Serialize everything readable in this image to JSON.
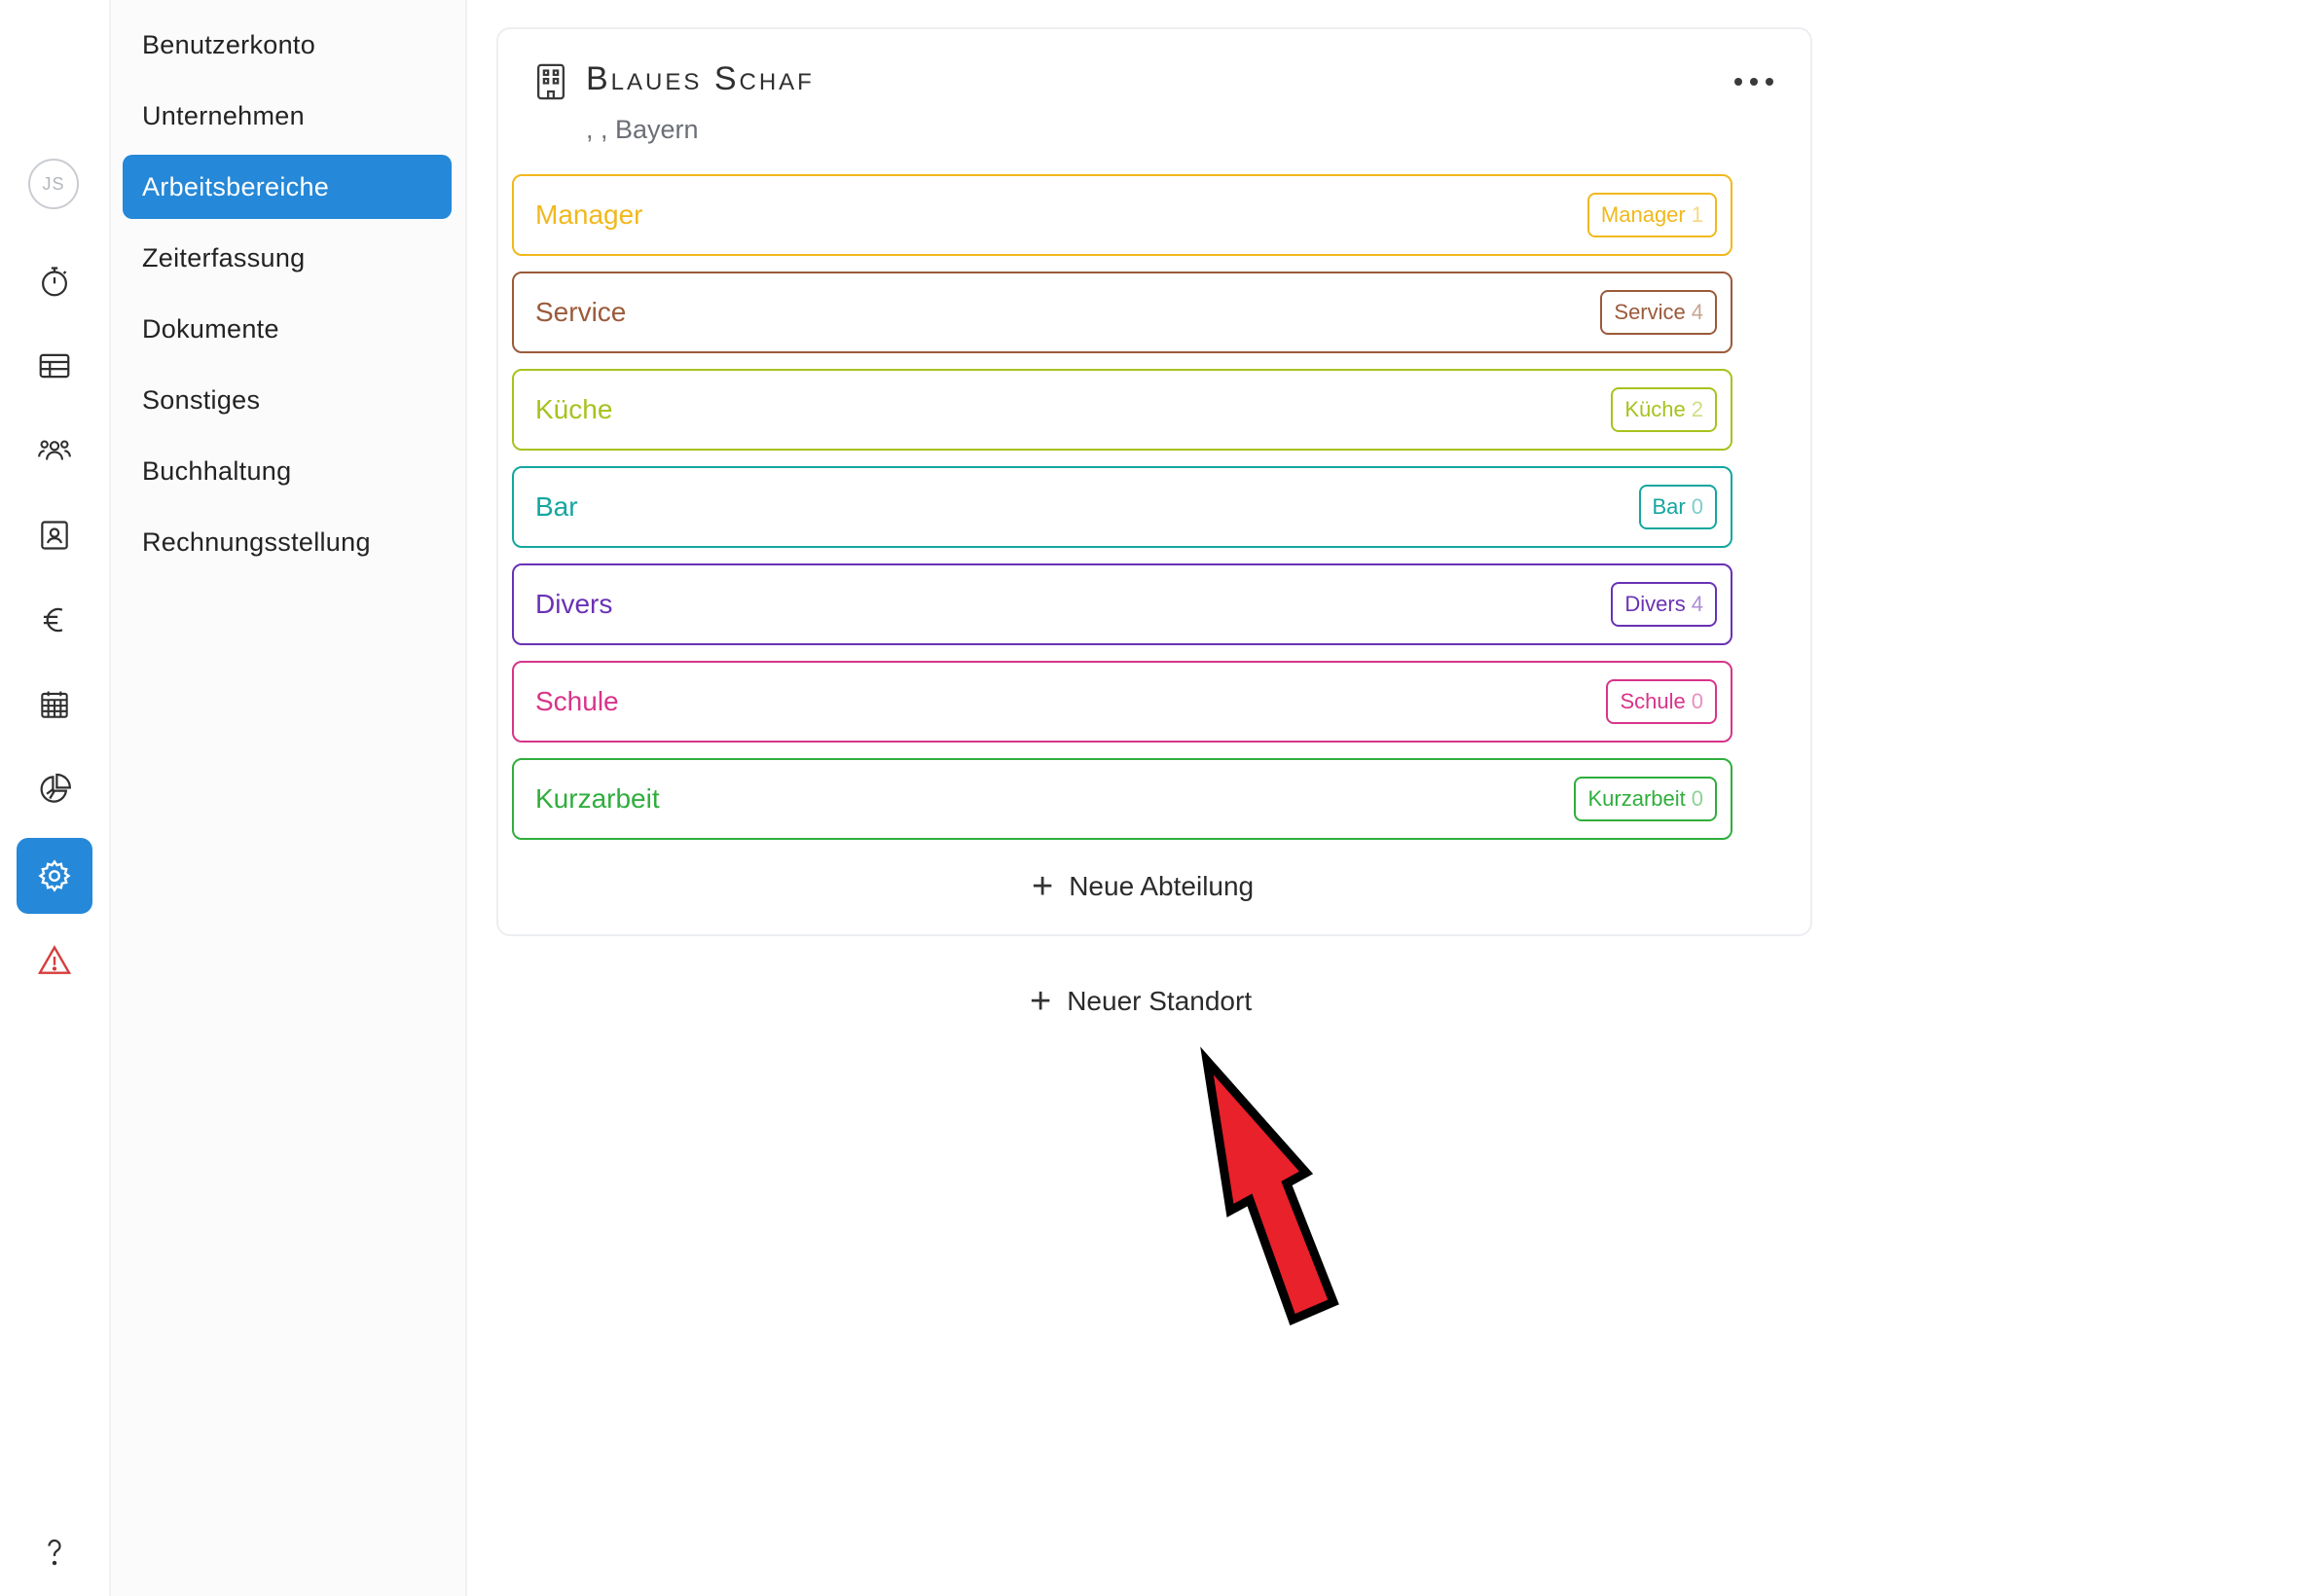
{
  "rail": {
    "avatar_initials": "JS",
    "icons": [
      "stopwatch-icon",
      "table-icon",
      "people-icon",
      "contact-card-icon",
      "euro-icon",
      "calendar-icon",
      "pie-chart-icon",
      "gear-icon",
      "warning-icon",
      "help-icon"
    ],
    "active_icon": "gear-icon",
    "warning_color": "#d63c3c",
    "active_color": "#2588d8"
  },
  "subnav": {
    "items": [
      {
        "label": "Benutzerkonto"
      },
      {
        "label": "Unternehmen"
      },
      {
        "label": "Arbeitsbereiche"
      },
      {
        "label": "Zeiterfassung"
      },
      {
        "label": "Dokumente"
      },
      {
        "label": "Sonstiges"
      },
      {
        "label": "Buchhaltung"
      },
      {
        "label": "Rechnungsstellung"
      }
    ],
    "active_item": "Arbeitsbereiche"
  },
  "location": {
    "title": "Blaues Schaf",
    "subtitle": ", , Bayern",
    "departments": [
      {
        "name": "Manager",
        "badge": "Manager",
        "count": "1",
        "color": "#f1b81d"
      },
      {
        "name": "Service",
        "badge": "Service",
        "count": "4",
        "color": "#9b5a3a"
      },
      {
        "name": "Küche",
        "badge": "Küche",
        "count": "2",
        "color": "#a8c21e"
      },
      {
        "name": "Bar",
        "badge": "Bar",
        "count": "0",
        "color": "#14a6a0"
      },
      {
        "name": "Divers",
        "badge": "Divers",
        "count": "4",
        "color": "#6a31b5"
      },
      {
        "name": "Schule",
        "badge": "Schule",
        "count": "0",
        "color": "#d8348a"
      },
      {
        "name": "Kurzarbeit",
        "badge": "Kurzarbeit",
        "count": "0",
        "color": "#2fae3c"
      }
    ],
    "add_department_label": "Neue Abteilung"
  },
  "add_location_label": "Neuer Standort",
  "annotation_arrow_color": "#e8212a"
}
